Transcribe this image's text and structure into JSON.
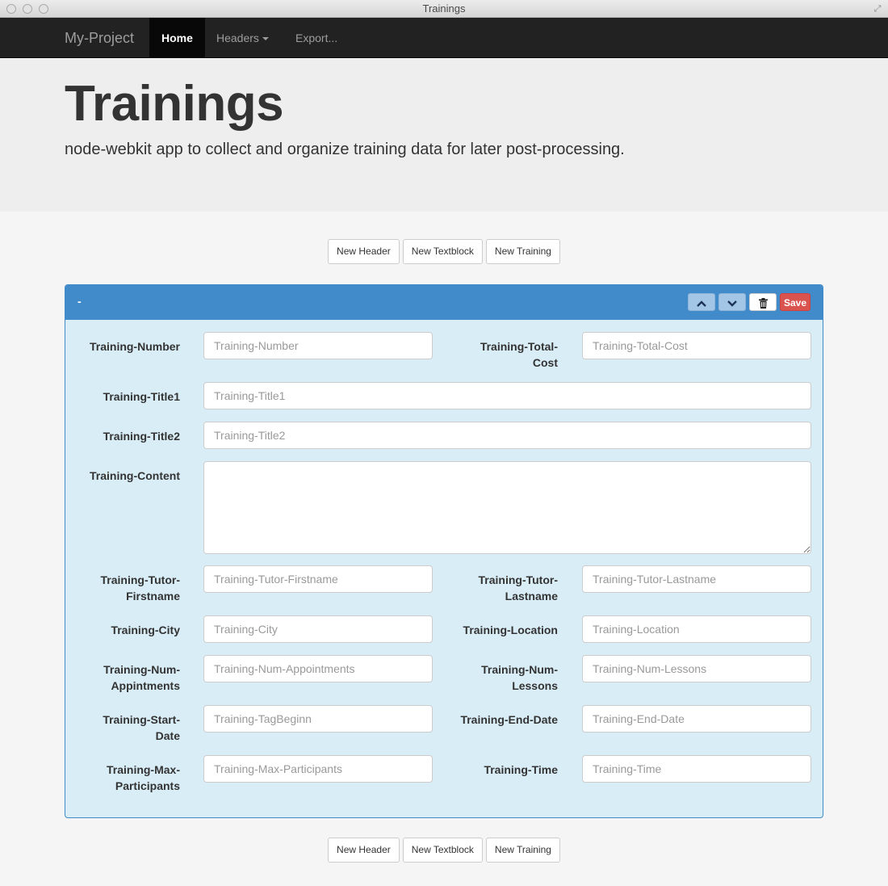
{
  "window": {
    "title": "Trainings"
  },
  "navbar": {
    "brand": "My-Project",
    "items": [
      {
        "label": "Home",
        "active": true
      },
      {
        "label": "Headers",
        "dropdown": true
      },
      {
        "label": "Export...",
        "dropdown": false
      }
    ]
  },
  "jumbotron": {
    "title": "Trainings",
    "subtitle": "node-webkit app to collect and organize training data for later post-processing."
  },
  "actions": {
    "new_header": "New Header",
    "new_textblock": "New Textblock",
    "new_training": "New Training"
  },
  "panel": {
    "title": "-",
    "save_label": "Save",
    "colors": {
      "heading": "#428bca",
      "body": "#d9edf7",
      "save": "#d9534f"
    },
    "icons": [
      "chevron-up-icon",
      "chevron-down-icon",
      "trash-icon"
    ]
  },
  "fields": {
    "number": {
      "label": "Training-Number",
      "placeholder": "Training-Number",
      "value": ""
    },
    "total_cost": {
      "label_1": "Training-Total-",
      "label_2": "Cost",
      "placeholder": "Training-Total-Cost",
      "value": ""
    },
    "title1": {
      "label": "Training-Title1",
      "placeholder": "Training-Title1",
      "value": ""
    },
    "title2": {
      "label": "Training-Title2",
      "placeholder": "Training-Title2",
      "value": ""
    },
    "content": {
      "label": "Training-Content",
      "value": ""
    },
    "tutor_firstname": {
      "label_1": "Training-Tutor-",
      "label_2": "Firstname",
      "placeholder": "Training-Tutor-Firstname",
      "value": ""
    },
    "tutor_lastname": {
      "label_1": "Training-Tutor-",
      "label_2": "Lastname",
      "placeholder": "Training-Tutor-Lastname",
      "value": ""
    },
    "city": {
      "label": "Training-City",
      "placeholder": "Training-City",
      "value": ""
    },
    "location": {
      "label": "Training-Location",
      "placeholder": "Training-Location",
      "value": ""
    },
    "num_appointments": {
      "label_1": "Training-Num-",
      "label_2": "Appintments",
      "placeholder": "Training-Num-Appointments",
      "value": ""
    },
    "num_lessons": {
      "label_1": "Training-Num-",
      "label_2": "Lessons",
      "placeholder": "Training-Num-Lessons",
      "value": ""
    },
    "start_date": {
      "label_1": "Training-Start-",
      "label_2": "Date",
      "placeholder": "Training-TagBeginn",
      "value": ""
    },
    "end_date": {
      "label": "Training-End-Date",
      "placeholder": "Training-End-Date",
      "value": ""
    },
    "max_participants": {
      "label_1": "Training-Max-",
      "label_2": "Participants",
      "placeholder": "Training-Max-Participants",
      "value": ""
    },
    "time": {
      "label": "Training-Time",
      "placeholder": "Training-Time",
      "value": ""
    }
  }
}
